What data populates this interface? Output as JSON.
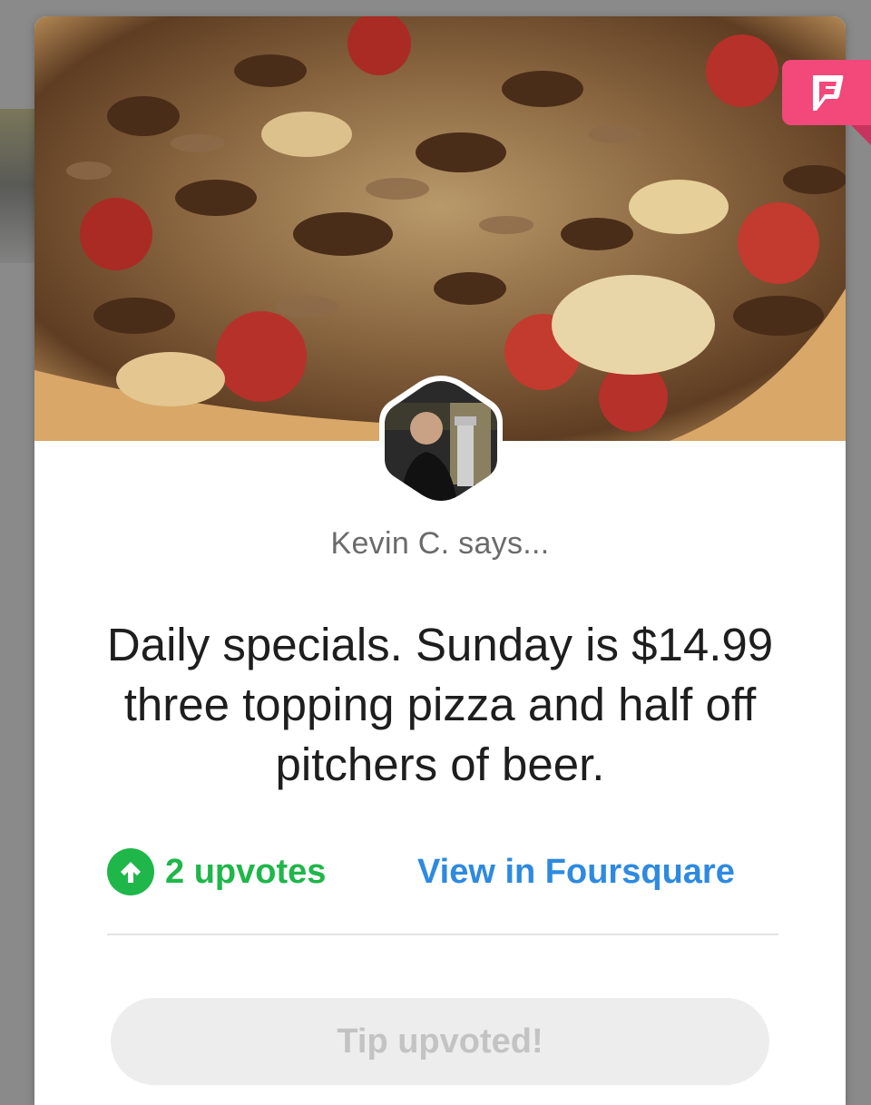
{
  "tip": {
    "author_line": "Kevin C. says...",
    "text": "Daily specials. Sunday is $14.99 three topping pizza and half off pitchers of beer.",
    "upvote_label": "2 upvotes",
    "view_link_label": "View in Foursquare",
    "status_button_label": "Tip upvoted!"
  },
  "icons": {
    "brand": "foursquare-logo-icon",
    "upvote": "arrow-up-icon",
    "photo": "pizza-photo",
    "avatar": "user-avatar"
  },
  "colors": {
    "brand_pink": "#f2487a",
    "upvote_green": "#1fb64a",
    "link_blue": "#2d8ae0"
  }
}
